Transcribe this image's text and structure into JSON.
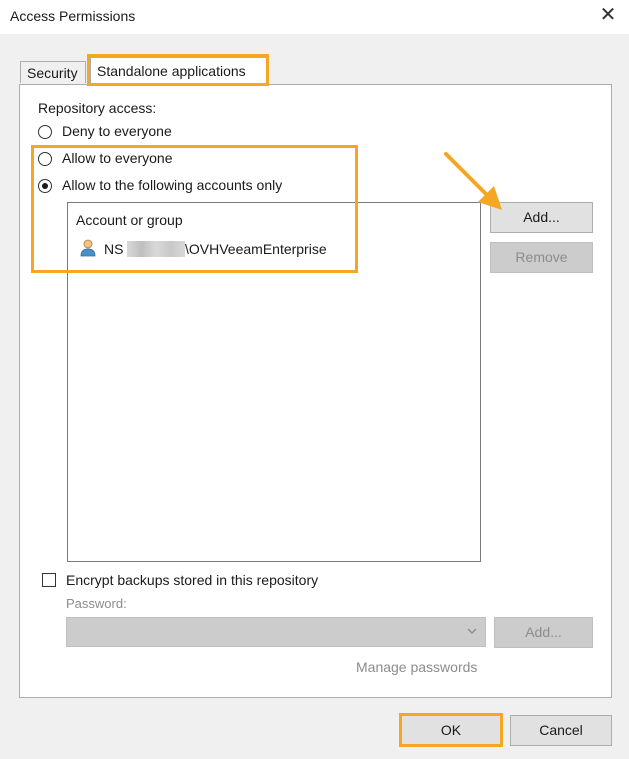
{
  "window": {
    "title": "Access Permissions",
    "close_glyph": "✕"
  },
  "tabs": {
    "security": "Security",
    "standalone": "Standalone applications"
  },
  "repository": {
    "label": "Repository access:",
    "options": [
      "Deny to everyone",
      "Allow to everyone",
      "Allow to the following accounts only"
    ],
    "selected": "Allow to the following accounts only"
  },
  "accounts": {
    "header": "Account or group",
    "entries": [
      {
        "prefix": "NS",
        "suffix": "\\OVHVeeamEnterprise",
        "icon": "user-icon"
      }
    ]
  },
  "buttons": {
    "add": "Add...",
    "remove": "Remove",
    "add_password": "Add...",
    "ok": "OK",
    "cancel": "Cancel"
  },
  "encrypt": {
    "label": "Encrypt backups stored in this repository",
    "checked": false
  },
  "password": {
    "label": "Password:",
    "value": ""
  },
  "manage_passwords": "Manage passwords",
  "colors": {
    "highlight": "#f5a623",
    "disabled_fill": "#cccccc"
  }
}
